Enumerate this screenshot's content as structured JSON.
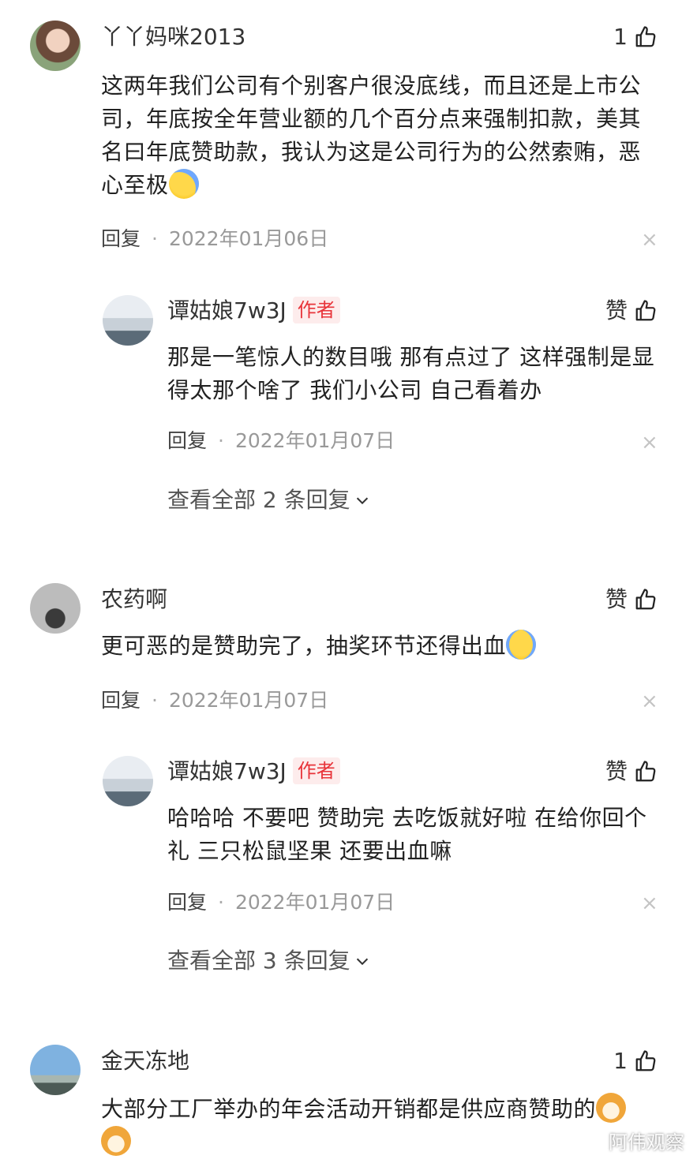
{
  "comments": [
    {
      "name": "丫丫妈咪2013",
      "likes": "1",
      "text": "这两年我们公司有个别客户很没底线，而且还是上市公司，年底按全年营业额的几个百分点来强制扣款，美其名曰年底赞助款，我认为这是公司行为的公然索贿，恶心至极",
      "reply_label": "回复",
      "date": "2022年01月06日",
      "emoji": "weary-face-icon",
      "reply": {
        "name": "谭姑娘7w3J",
        "badge": "作者",
        "likes": "赞",
        "text": "那是一笔惊人的数目哦 那有点过了 这样强制是显得太那个啥了 我们小公司 自己看着办",
        "reply_label": "回复",
        "date": "2022年01月07日"
      },
      "view_all": "查看全部 2 条回复"
    },
    {
      "name": "农药啊",
      "likes": "赞",
      "text": "更可恶的是赞助完了，抽奖环节还得出血",
      "reply_label": "回复",
      "date": "2022年01月07日",
      "emoji": "crying-face-icon",
      "reply": {
        "name": "谭姑娘7w3J",
        "badge": "作者",
        "likes": "赞",
        "text": "哈哈哈 不要吧 赞助完 去吃饭就好啦 在给你回个礼 三只松鼠坚果 还要出血嘛",
        "reply_label": "回复",
        "date": "2022年01月07日"
      },
      "view_all": "查看全部 3 条回复"
    },
    {
      "name": "金天冻地",
      "likes": "1",
      "text": "大部分工厂举办的年会活动开销都是供应商赞助的",
      "emoji": "dog-face-icon"
    }
  ],
  "close_symbol": "×",
  "dot": "·",
  "watermark": "阿伟观察",
  "colors": {
    "author_badge": "#e8343a",
    "meta": "#999999",
    "text": "#222222"
  }
}
